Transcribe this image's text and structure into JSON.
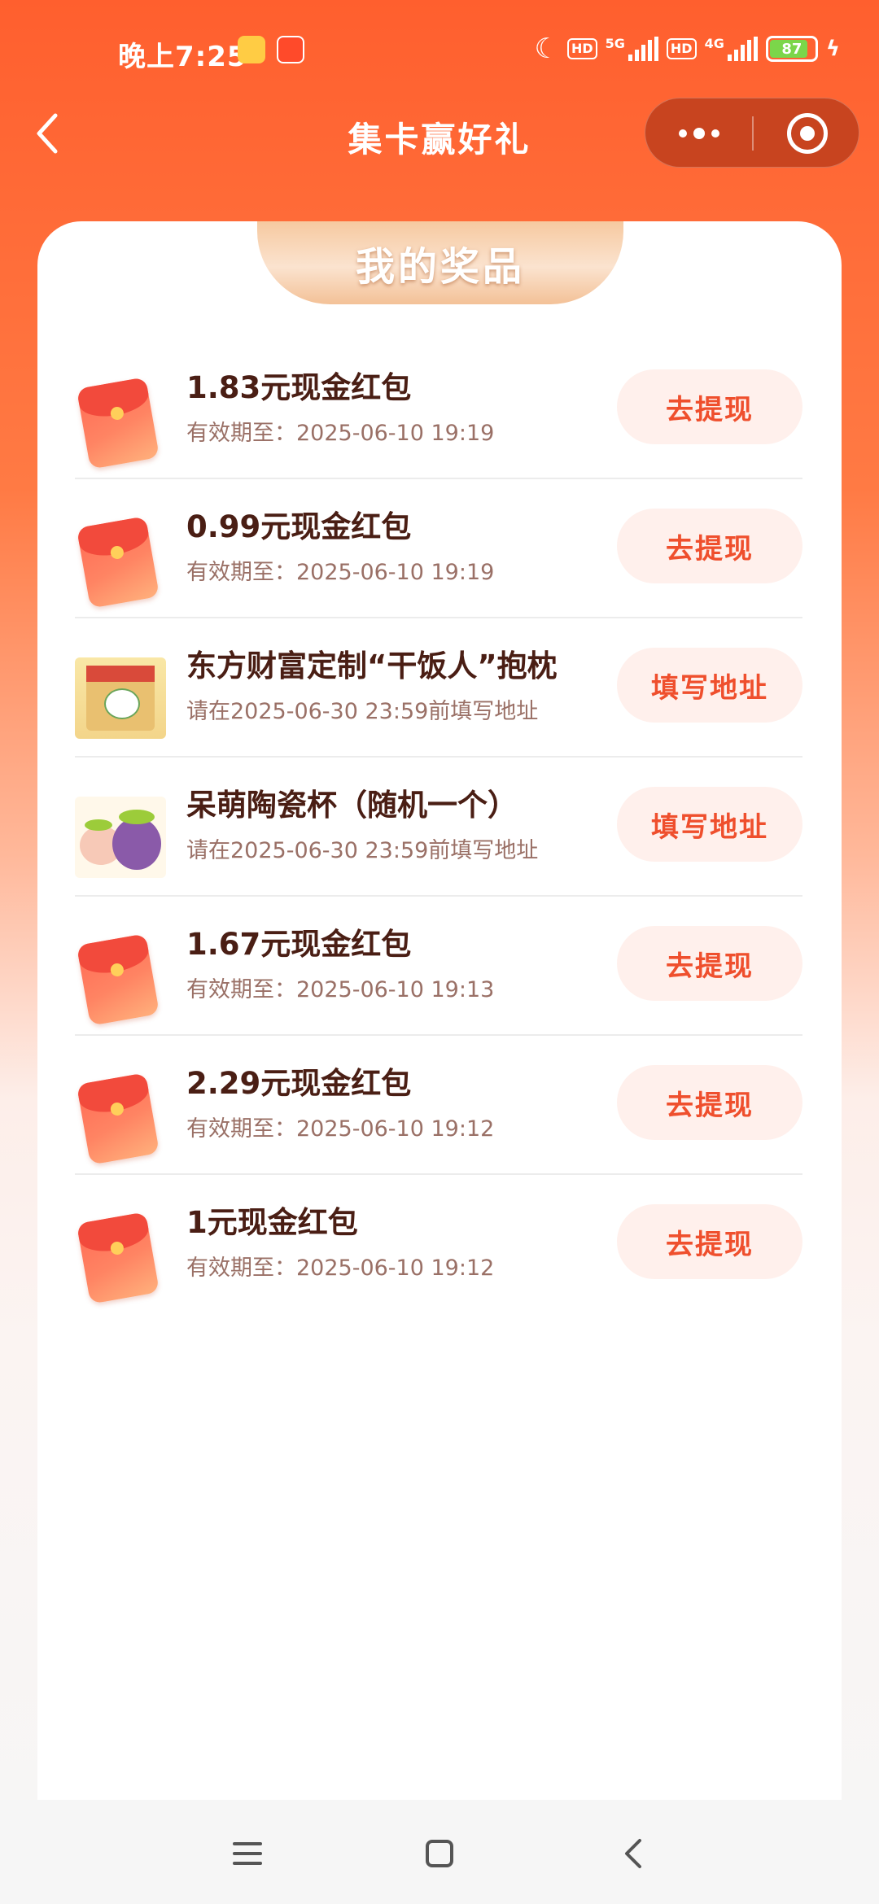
{
  "status_bar": {
    "time": "晚上7:25",
    "network1": "5G",
    "network2": "4G",
    "hd": "HD",
    "battery": "87"
  },
  "nav": {
    "title": "集卡赢好礼"
  },
  "section": {
    "title": "我的奖品"
  },
  "prizes": [
    {
      "icon": "red-packet",
      "title": "1.83元现金红包",
      "subtitle": "有效期至：2025-06-10 19:19",
      "action": "去提现"
    },
    {
      "icon": "red-packet",
      "title": "0.99元现金红包",
      "subtitle": "有效期至：2025-06-10 19:19",
      "action": "去提现"
    },
    {
      "icon": "pillow",
      "title": "东方财富定制“干饭人”抱枕",
      "subtitle": "请在2025-06-30 23:59前填写地址",
      "action": "填写地址"
    },
    {
      "icon": "cup",
      "title": "呆萌陶瓷杯（随机一个）",
      "subtitle": "请在2025-06-30 23:59前填写地址",
      "action": "填写地址"
    },
    {
      "icon": "red-packet",
      "title": "1.67元现金红包",
      "subtitle": "有效期至：2025-06-10 19:13",
      "action": "去提现"
    },
    {
      "icon": "red-packet",
      "title": "2.29元现金红包",
      "subtitle": "有效期至：2025-06-10 19:12",
      "action": "去提现"
    },
    {
      "icon": "red-packet",
      "title": "1元现金红包",
      "subtitle": "有效期至：2025-06-10 19:12",
      "action": "去提现"
    }
  ],
  "colors": {
    "brand": "#ff5f2e",
    "button_text": "#ef4f2d",
    "button_bg": "#fff0ec",
    "title_text": "#4a1e14"
  }
}
